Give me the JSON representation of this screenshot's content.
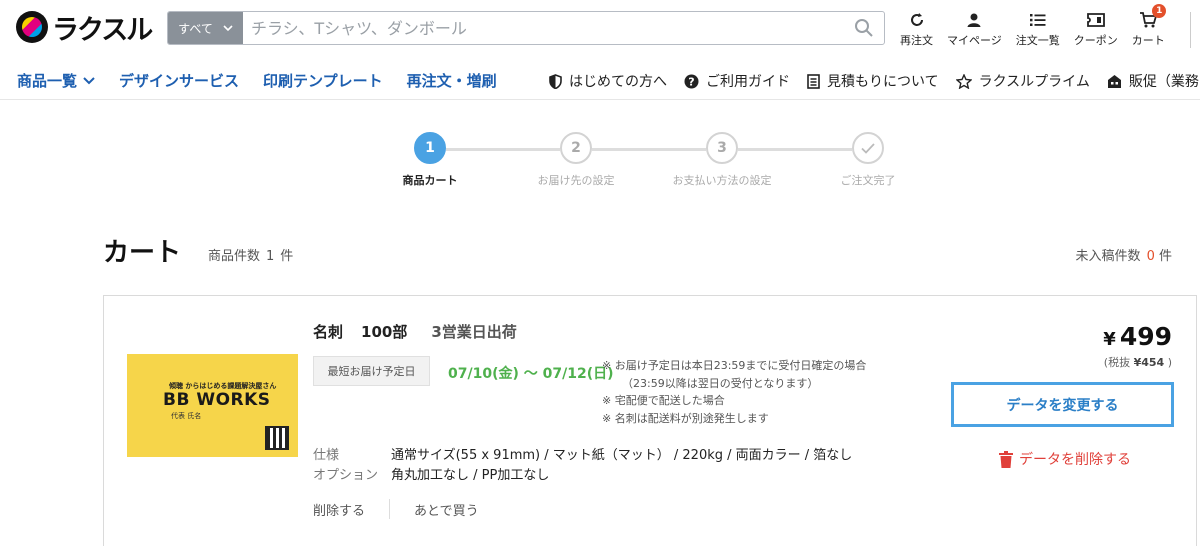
{
  "header": {
    "logo_text": "ラクスル",
    "search": {
      "category": "すべて",
      "placeholder": "チラシ、Tシャツ、ダンボール"
    },
    "icons": [
      {
        "name": "reorder",
        "label": "再注文"
      },
      {
        "name": "mypage",
        "label": "マイページ"
      },
      {
        "name": "orders",
        "label": "注文一覧"
      },
      {
        "name": "coupon",
        "label": "クーポン"
      },
      {
        "name": "cart",
        "label": "カート",
        "badge": "1"
      }
    ]
  },
  "nav": {
    "left": [
      "商品一覧",
      "デザインサービス",
      "印刷テンプレート",
      "再注文・増刷"
    ],
    "right": [
      "はじめての方へ",
      "ご利用ガイド",
      "見積もりについて",
      "ラクスルプライム",
      "販促（業務)"
    ]
  },
  "steps": [
    {
      "num": "1",
      "label": "商品カート"
    },
    {
      "num": "2",
      "label": "お届け先の設定"
    },
    {
      "num": "3",
      "label": "お支払い方法の設定"
    },
    {
      "num": "",
      "label": "ご注文完了"
    }
  ],
  "cart": {
    "title": "カート",
    "count_label": "商品件数",
    "count": "1",
    "count_unit": "件",
    "pending_label": "未入稿件数",
    "pending_count": "0",
    "pending_unit": "件"
  },
  "item": {
    "name": "名刺",
    "quantity": "100部",
    "shipping": "3営業日出荷",
    "delivery_label": "最短お届け予定日",
    "delivery_date": "07/10(金) 〜 07/12(日)",
    "notes": [
      "※ お届け予定日は本日23:59までに受付日確定の場合",
      "（23:59以降は翌日の受付となります）",
      "※ 宅配便で配送した場合",
      "※ 名刺は配送料が別途発生します"
    ],
    "spec_label": "仕様",
    "spec_value": "通常サイズ(55 x 91mm) / マット紙（マット） / 220kg / 両面カラー / 箔なし",
    "option_label": "オプション",
    "option_value": "角丸加工なし / PP加工なし",
    "delete_link": "削除する",
    "later_link": "あとで買う",
    "price_yen": "¥",
    "price": "499",
    "price_sub_prefix": "(税抜",
    "price_sub_value": "¥454",
    "price_sub_suffix": ")",
    "change_button": "データを変更する",
    "delete_data_button": "データを削除する",
    "thumbnail": {
      "line1": "傾聴 からはじめる課題解決屋さん",
      "brand": "BB WORKS",
      "line3": "代表 氏名"
    }
  },
  "colors": {
    "nav_link": "#1e5fb0",
    "step_active": "#4aa2e3",
    "delivery_green": "#4fb14d",
    "delete_red": "#e0403a",
    "badge": "#e3502b",
    "card_yellow": "#f6d54a"
  }
}
